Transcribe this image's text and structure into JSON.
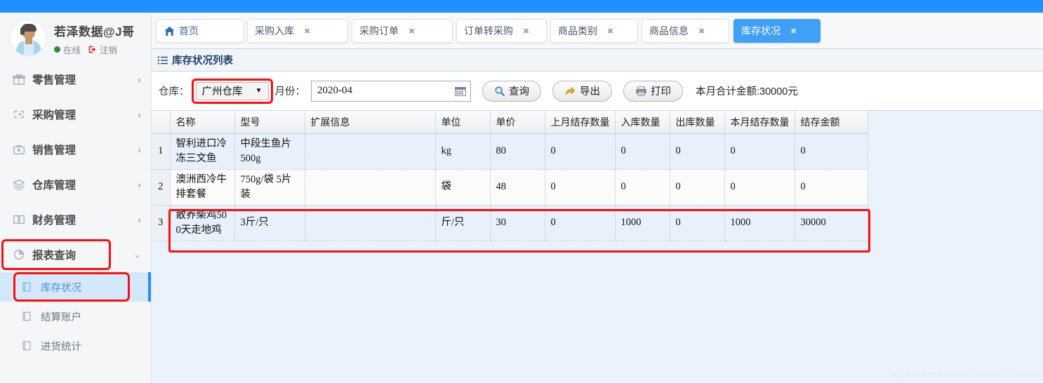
{
  "colors": {
    "topbar": "#1e90ff",
    "accent": "#3fa0f7",
    "highlight_red": "#fd0d0d",
    "active_sub": "#d4e8fb",
    "content_bg": "#eaf2fc"
  },
  "user": {
    "name": "若泽数据@J哥",
    "status": "在线",
    "logout": "注销",
    "avatar_icon": "user-avatar-icon",
    "online_dot_icon": "online-status-dot-icon",
    "logout_icon": "logout-icon"
  },
  "sidebar": {
    "items": [
      {
        "label": "零售管理",
        "icon": "gift-icon",
        "arrow": "‹",
        "expanded": false
      },
      {
        "label": "采购管理",
        "icon": "purchase-icon",
        "arrow": "‹",
        "expanded": false
      },
      {
        "label": "销售管理",
        "icon": "briefcase-icon",
        "arrow": "‹",
        "expanded": false
      },
      {
        "label": "仓库管理",
        "icon": "layers-icon",
        "arrow": "‹",
        "expanded": false
      },
      {
        "label": "财务管理",
        "icon": "book-icon",
        "arrow": "‹",
        "expanded": false
      },
      {
        "label": "报表查询",
        "icon": "pie-chart-icon",
        "arrow": "⌄",
        "expanded": true,
        "highlighted": true
      }
    ],
    "sub_items": [
      {
        "label": "库存状况",
        "icon": "report-page-icon",
        "active": true,
        "highlighted": true
      },
      {
        "label": "结算账户",
        "icon": "report-page-icon",
        "active": false,
        "highlighted": false
      },
      {
        "label": "进货统计",
        "icon": "report-page-icon",
        "active": false,
        "highlighted": false
      }
    ]
  },
  "tabs": [
    {
      "label": "首页",
      "closable": false,
      "active": false,
      "icon": "home-icon"
    },
    {
      "label": "采购入库",
      "closable": true,
      "active": false
    },
    {
      "label": "采购订单",
      "closable": true,
      "active": false
    },
    {
      "label": "订单转采购",
      "closable": true,
      "active": false
    },
    {
      "label": "商品类别",
      "closable": true,
      "active": false
    },
    {
      "label": "商品信息",
      "closable": true,
      "active": false
    },
    {
      "label": "库存状况",
      "closable": true,
      "active": true
    }
  ],
  "tab_close_glyph": "✖",
  "panel": {
    "title": "库存状况列表",
    "icon": "list-icon"
  },
  "toolbar": {
    "warehouse_label": "仓库：",
    "warehouse_value": "广州仓库",
    "warehouse_caret": "▼",
    "month_label": "月份：",
    "month_value": "2020-04",
    "calendar_icon": "calendar-icon",
    "query_button": "查询",
    "query_icon": "search-icon",
    "export_button": "导出",
    "export_icon": "export-arrow-icon",
    "print_button": "打印",
    "print_icon": "printer-icon",
    "total_text": "本月合计金额:30000元"
  },
  "table": {
    "index_header": "",
    "headers": [
      "名称",
      "型号",
      "扩展信息",
      "单位",
      "单价",
      "上月结存数量",
      "入库数量",
      "出库数量",
      "本月结存数量",
      "结存金额"
    ],
    "rows": [
      {
        "index": "1",
        "name": "智利进口冷冻三文鱼",
        "model": "中段生鱼片 500g",
        "ext": "",
        "unit": "kg",
        "price": "80",
        "last_balance": "0",
        "in_qty": "0",
        "out_qty": "0",
        "month_balance": "0",
        "balance_amount": "0",
        "highlighted": false
      },
      {
        "index": "2",
        "name": "澳洲西冷牛排套餐",
        "model": "750g/袋 5片装",
        "ext": "",
        "unit": "袋",
        "price": "48",
        "last_balance": "0",
        "in_qty": "0",
        "out_qty": "0",
        "month_balance": "0",
        "balance_amount": "0",
        "highlighted": false
      },
      {
        "index": "3",
        "name": "散养柴鸡500天走地鸡",
        "model": "3斤/只",
        "ext": "",
        "unit": "斤/只",
        "price": "30",
        "last_balance": "0",
        "in_qty": "1000",
        "out_qty": "0",
        "month_balance": "1000",
        "balance_amount": "30000",
        "highlighted": true
      }
    ]
  },
  "watermark": "https://blog.csdn.net/SparkOnYarn"
}
